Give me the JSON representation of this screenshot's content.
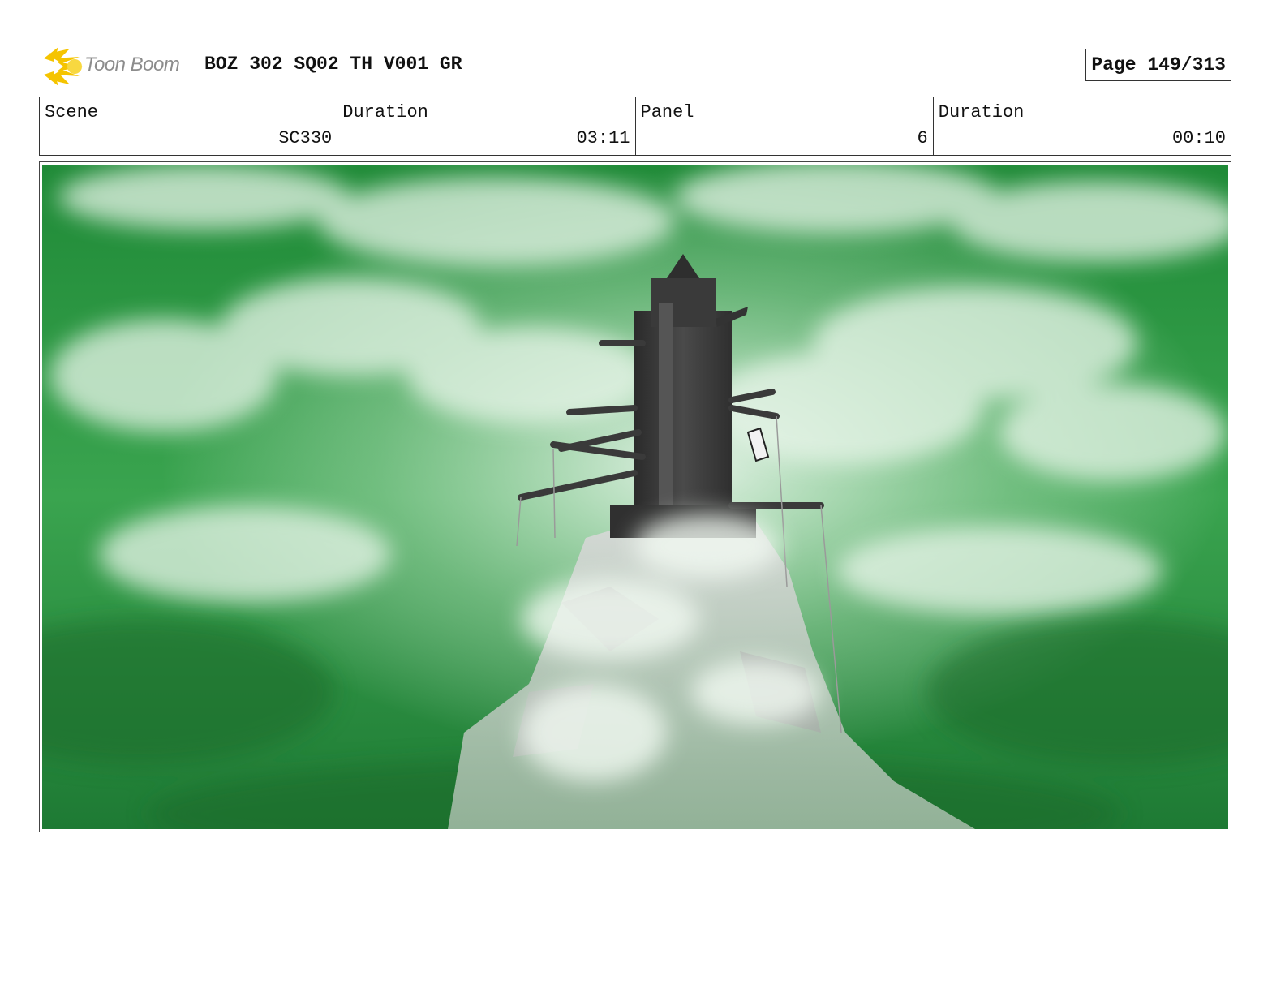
{
  "header": {
    "logo_text": "Toon Boom",
    "title": "BOZ 302 SQ02 TH V001 GR",
    "page": "Page 149/313"
  },
  "info": {
    "scene_label": "Scene",
    "scene_value": "SC330",
    "scene_duration_label": "Duration",
    "scene_duration_value": "03:11",
    "panel_label": "Panel",
    "panel_value": "6",
    "panel_duration_label": "Duration",
    "panel_duration_value": "00:10"
  },
  "colors": {
    "sky_green": "#2f9a44",
    "cloud": "#e9f5ea",
    "tower": "#3c3c3c",
    "rock": "#c9c9c9",
    "logo_yellow": "#f5c400"
  }
}
